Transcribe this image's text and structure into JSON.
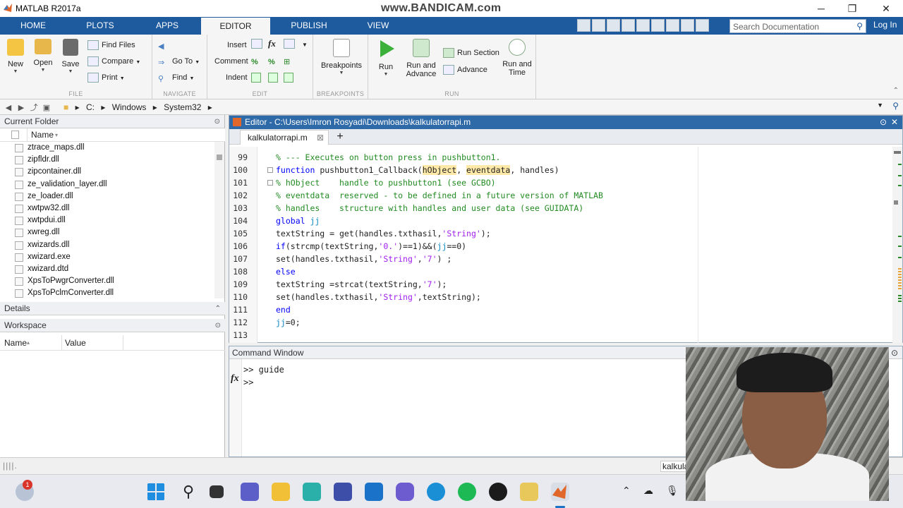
{
  "window": {
    "title": "MATLAB R2017a",
    "watermark": "www.BANDICAM.com",
    "minimize": "─",
    "maximize": "❐",
    "close": "✕"
  },
  "toptabs": [
    "HOME",
    "PLOTS",
    "APPS",
    "EDITOR",
    "PUBLISH",
    "VIEW"
  ],
  "active_tab": "EDITOR",
  "search": {
    "placeholder": "Search Documentation"
  },
  "login": "Log In",
  "ribbon": {
    "file": {
      "label": "FILE",
      "new": "New",
      "open": "Open",
      "save": "Save",
      "find_files": "Find Files",
      "compare": "Compare",
      "print": "Print"
    },
    "navigate": {
      "label": "NAVIGATE",
      "goto": "Go To",
      "find": "Find"
    },
    "edit": {
      "label": "EDIT",
      "insert": "Insert",
      "comment": "Comment",
      "indent": "Indent",
      "fx": "fx"
    },
    "breakpoints": {
      "label": "BREAKPOINTS",
      "btn": "Breakpoints"
    },
    "run": {
      "label": "RUN",
      "run": "Run",
      "run_advance": "Run and Advance",
      "run_section": "Run Section",
      "advance": "Advance",
      "run_time": "Run and Time"
    }
  },
  "address": {
    "crumbs": [
      "C:",
      "Windows",
      "System32"
    ]
  },
  "current_folder": {
    "title": "Current Folder",
    "col_name": "Name",
    "files": [
      "ztrace_maps.dll",
      "zipfldr.dll",
      "zipcontainer.dll",
      "ze_validation_layer.dll",
      "ze_loader.dll",
      "xwtpw32.dll",
      "xwtpdui.dll",
      "xwreg.dll",
      "xwizards.dll",
      "xwizard.exe",
      "xwizard.dtd",
      "XpsToPwgrConverter.dll",
      "XpsToPclmConverter.dll"
    ]
  },
  "details": {
    "title": "Details"
  },
  "workspace": {
    "title": "Workspace",
    "col_name": "Name",
    "col_value": "Value"
  },
  "editor": {
    "header": "Editor - C:\\Users\\Imron Rosyadi\\Downloads\\kalkulatorrapi.m",
    "tab": "kalkulatorrapi.m",
    "lines": [
      {
        "n": "99",
        "t": "% --- Executes on button press in pushbutton1."
      },
      {
        "n": "100",
        "t": "function pushbutton1_Callback(hObject, eventdata, handles)"
      },
      {
        "n": "101",
        "t": "% hObject    handle to pushbutton1 (see GCBO)"
      },
      {
        "n": "102",
        "t": "% eventdata  reserved - to be defined in a future version of MATLAB"
      },
      {
        "n": "103",
        "t": "% handles    structure with handles and user data (see GUIDATA)"
      },
      {
        "n": "104",
        "t": "global jj"
      },
      {
        "n": "105",
        "t": "textString = get(handles.txthasil,'String');"
      },
      {
        "n": "106",
        "t": "if(strcmp(textString,'0.')==1)&&(jj==0)"
      },
      {
        "n": "107",
        "t": "set(handles.txthasil,'String','7') ;"
      },
      {
        "n": "108",
        "t": "else"
      },
      {
        "n": "109",
        "t": "textString =strcat(textString,'7');"
      },
      {
        "n": "110",
        "t": "set(handles.txthasil,'String',textString);"
      },
      {
        "n": "111",
        "t": "end"
      },
      {
        "n": "112",
        "t": "jj=0;"
      },
      {
        "n": "113",
        "t": ""
      }
    ]
  },
  "command_window": {
    "title": "Command Window",
    "lines": [
      ">> guide",
      ">>"
    ],
    "fx": "fx"
  },
  "status": {
    "text": "kalkula"
  },
  "taskbar": {
    "badge": "1"
  }
}
